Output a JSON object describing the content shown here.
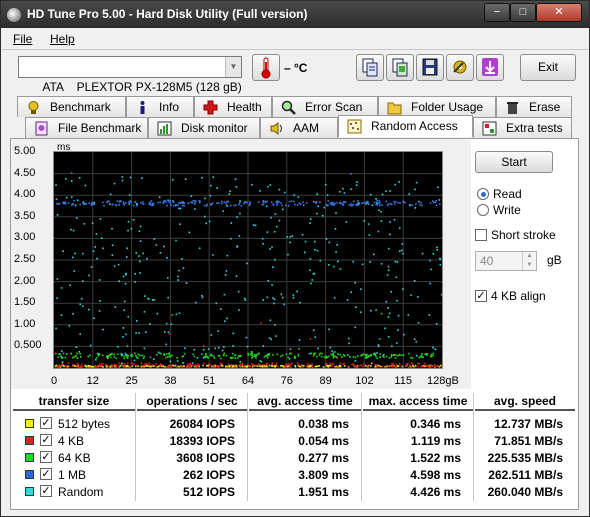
{
  "window": {
    "title": "HD Tune Pro 5.00 - Hard Disk Utility (Full version)",
    "min_label": "−",
    "max_label": "□",
    "close_label": "✕"
  },
  "menu": {
    "file": "File",
    "help": "Help"
  },
  "toolbar": {
    "drive": "ATA    PLEXTOR PX-128M5 (128 gB)",
    "temperature": "– °C",
    "exit_label": "Exit",
    "icons": [
      "copy-icon",
      "copy-screen-icon",
      "save-icon",
      "options-icon",
      "download-icon"
    ]
  },
  "tabs_row1": [
    "Benchmark",
    "Info",
    "Health",
    "Error Scan",
    "Folder Usage",
    "Erase"
  ],
  "tabs_row2": [
    "File Benchmark",
    "Disk monitor",
    "AAM",
    "Random Access",
    "Extra tests"
  ],
  "active_tab": "Random Access",
  "controls": {
    "start_label": "Start",
    "read_label": "Read",
    "write_label": "Write",
    "read_selected": true,
    "short_stroke_label": "Short stroke",
    "short_stroke_checked": false,
    "short_stroke_value": "40",
    "gb_unit": "gB",
    "align_label": "4 KB align",
    "align_checked": true
  },
  "chart_data": {
    "type": "scatter",
    "yunit": "ms",
    "y_ticks": [
      "5.00",
      "4.50",
      "4.00",
      "3.50",
      "3.00",
      "2.50",
      "2.00",
      "1.50",
      "1.00",
      "0.500"
    ],
    "x_ticks": [
      "0",
      "12",
      "25",
      "38",
      "51",
      "64",
      "76",
      "89",
      "102",
      "115",
      "128gB"
    ],
    "ylim": [
      0,
      5
    ],
    "xlim": [
      0,
      128
    ],
    "grid": true,
    "series": [
      {
        "name": "512 bytes",
        "color": "#e8e818",
        "level_ms": 0.038,
        "max_ms": 0.346
      },
      {
        "name": "4 KB",
        "color": "#e02020",
        "level_ms": 0.054,
        "max_ms": 1.119
      },
      {
        "name": "64 KB",
        "color": "#20d820",
        "level_ms": 0.277,
        "max_ms": 1.522
      },
      {
        "name": "1 MB",
        "color": "#3a7ae8",
        "level_ms": 3.809,
        "max_ms": 4.598
      },
      {
        "name": "Random",
        "color": "#30d8e0",
        "level_ms": 1.951,
        "max_ms": 4.426
      }
    ]
  },
  "results": {
    "headers": [
      "transfer size",
      "operations / sec",
      "avg. access time",
      "max. access time",
      "avg. speed"
    ],
    "rows": [
      {
        "size": "512 bytes",
        "color": "#f0f020",
        "ops": "26084 IOPS",
        "avg": "0.038 ms",
        "max": "0.346 ms",
        "speed": "12.737 MB/s"
      },
      {
        "size": "4 KB",
        "color": "#e02020",
        "ops": "18393 IOPS",
        "avg": "0.054 ms",
        "max": "1.119 ms",
        "speed": "71.851 MB/s"
      },
      {
        "size": "64 KB",
        "color": "#20d820",
        "ops": "3608 IOPS",
        "avg": "0.277 ms",
        "max": "1.522 ms",
        "speed": "225.535 MB/s"
      },
      {
        "size": "1 MB",
        "color": "#2a6ad8",
        "ops": "262 IOPS",
        "avg": "3.809 ms",
        "max": "4.598 ms",
        "speed": "262.511 MB/s"
      },
      {
        "size": "Random",
        "color": "#30d8e0",
        "ops": "512 IOPS",
        "avg": "1.951 ms",
        "max": "4.426 ms",
        "speed": "260.040 MB/s"
      }
    ]
  }
}
